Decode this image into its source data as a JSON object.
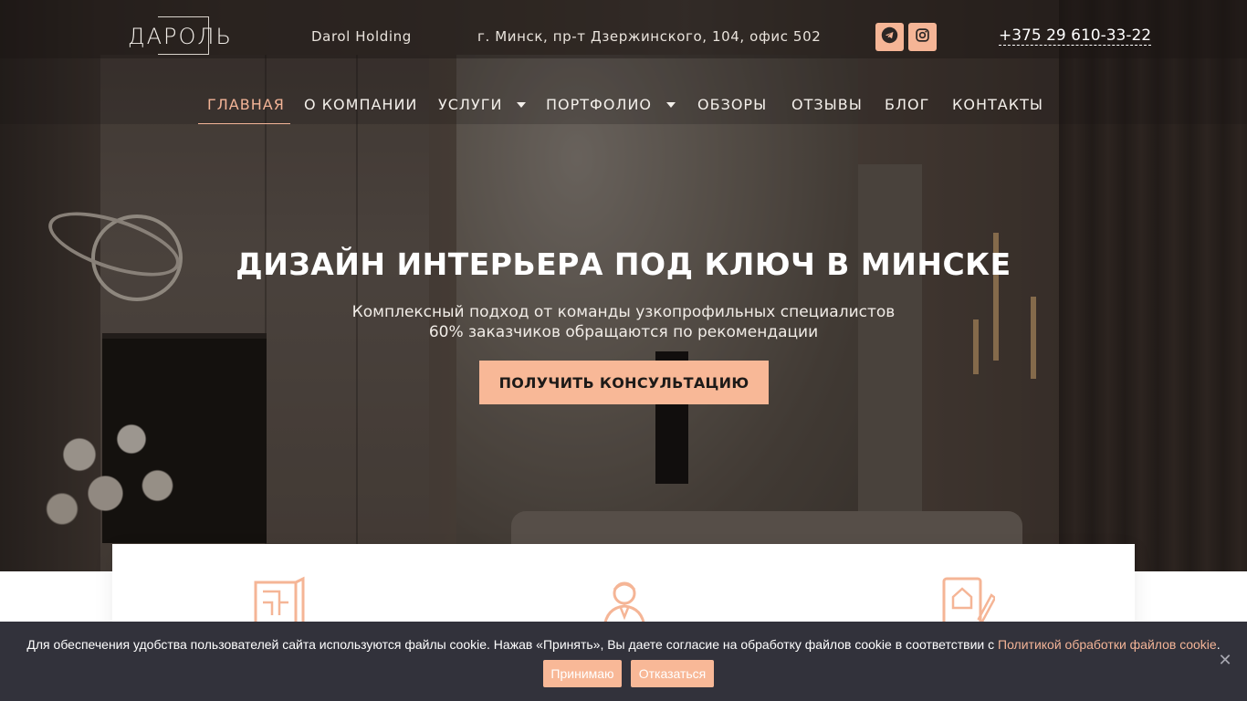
{
  "header": {
    "logo_text": "ДАРОЛЬ",
    "company": "Darol Holding",
    "address": "г. Минск, пр-т Дзержинского, 104, офис 502",
    "phone": "+375 29 610-33-22",
    "social": [
      {
        "name": "telegram-icon"
      },
      {
        "name": "instagram-icon"
      }
    ]
  },
  "nav": {
    "items": [
      {
        "label": "ГЛАВНАЯ",
        "active": true
      },
      {
        "label": "О КОМПАНИИ"
      },
      {
        "label": "УСЛУГИ",
        "dropdown": true
      },
      {
        "label": "ПОРТФОЛИО",
        "dropdown": true
      },
      {
        "label": "ОБЗОРЫ"
      },
      {
        "label": "ОТЗЫВЫ"
      },
      {
        "label": "БЛОГ"
      },
      {
        "label": "КОНТАКТЫ"
      }
    ]
  },
  "hero": {
    "title": "ДИЗАЙН ИНТЕРЬЕРА ПОД КЛЮЧ В МИНСКЕ",
    "subtitle_line1": "Комплексный подход от команды узкопрофильных специалистов",
    "subtitle_line2": "60% заказчиков обращаются по рекомендации",
    "cta_label": "ПОЛУЧИТЬ КОНСУЛЬТАЦИЮ"
  },
  "features": {
    "icons": [
      "blueprint-icon",
      "designer-icon",
      "house-document-icon"
    ]
  },
  "cookie": {
    "text": "Для обеспечения удобства пользователей сайта используются файлы cookie. Нажав «Принять», Вы даете согласие на обработку файлов cookie в соответствии с",
    "link_text": "Политикой обработки файлов cookie",
    "accept_label": "Принимаю",
    "decline_label": "Отказаться",
    "close_glyph": "✕"
  },
  "colors": {
    "accent": "#f8b897",
    "cookie_bg": "#32323b"
  }
}
